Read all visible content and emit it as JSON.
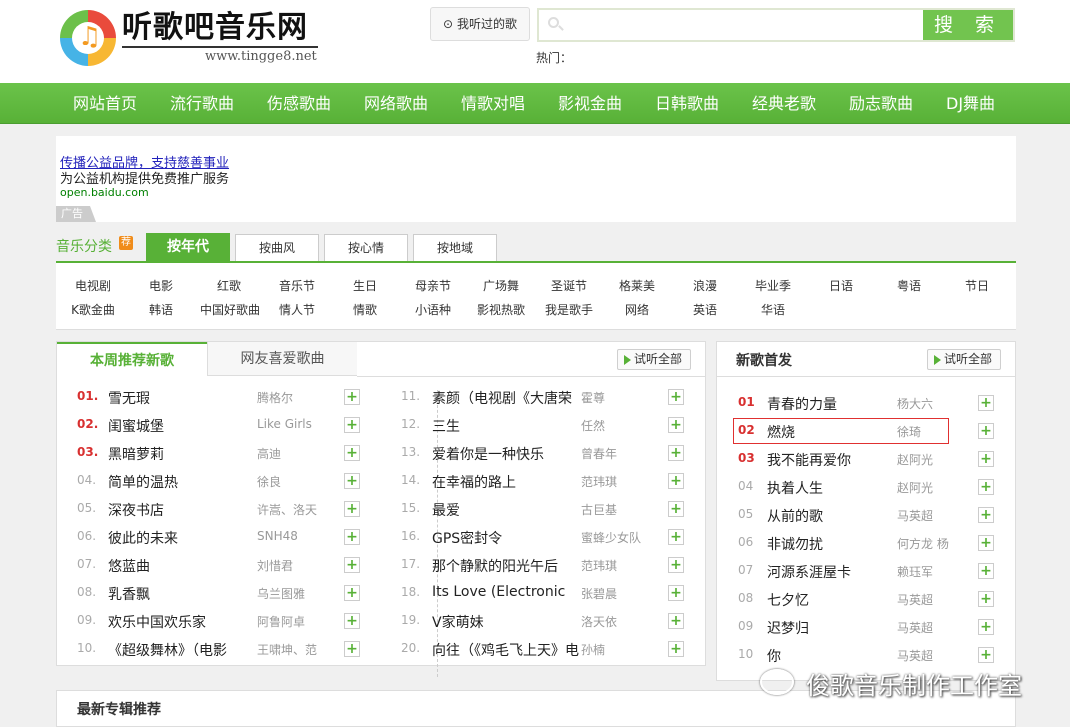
{
  "header": {
    "logo_note": "♫",
    "site_title": "听歌吧音乐网",
    "site_url": "www.tingge8.net",
    "history_label": "我听过的歌",
    "search_placeholder": "",
    "search_button": "搜 索",
    "hot_label": "热门："
  },
  "nav": [
    "网站首页",
    "流行歌曲",
    "伤感歌曲",
    "网络歌曲",
    "情歌对唱",
    "影视金曲",
    "日韩歌曲",
    "经典老歌",
    "励志歌曲",
    "DJ舞曲"
  ],
  "ad": {
    "link": "传播公益品牌，支持慈善事业",
    "description": "为公益机构提供免费推广服务",
    "url": "open.baidu.com",
    "tag": "广告"
  },
  "categories": {
    "label": "音乐分类",
    "badge": "荐",
    "tabs": [
      "按年代",
      "按曲风",
      "按心情",
      "按地域"
    ],
    "active_tab": 0,
    "row1": [
      "电视剧",
      "电影",
      "红歌",
      "音乐节",
      "生日",
      "母亲节",
      "广场舞",
      "圣诞节",
      "格莱美",
      "浪漫",
      "毕业季",
      "日语",
      "粤语",
      "节日"
    ],
    "row2": [
      "K歌金曲",
      "韩语",
      "中国好歌曲",
      "情人节",
      "情歌",
      "小语种",
      "影视热歌",
      "我是歌手",
      "网络",
      "英语",
      "华语"
    ]
  },
  "weekly": {
    "tabs": [
      "本周推荐新歌",
      "网友喜爱歌曲"
    ],
    "listen_all": "试听全部",
    "songs": [
      {
        "num": "01.",
        "title": "雪无瑕",
        "artist": "腾格尔"
      },
      {
        "num": "02.",
        "title": "闺蜜城堡",
        "artist": "Like Girls"
      },
      {
        "num": "03.",
        "title": "黑暗萝莉",
        "artist": "高迪"
      },
      {
        "num": "04.",
        "title": "简单的温热",
        "artist": "徐良"
      },
      {
        "num": "05.",
        "title": "深夜书店",
        "artist": "许嵩、洛天"
      },
      {
        "num": "06.",
        "title": "彼此的未来",
        "artist": "SNH48"
      },
      {
        "num": "07.",
        "title": "悠蓝曲",
        "artist": "刘惜君"
      },
      {
        "num": "08.",
        "title": "乳香飘",
        "artist": "乌兰图雅"
      },
      {
        "num": "09.",
        "title": "欢乐中国欢乐家",
        "artist": "阿鲁阿卓"
      },
      {
        "num": "10.",
        "title": "《超级舞林》（电影",
        "artist": "王啸坤、范"
      },
      {
        "num": "11.",
        "title": "素颜（电视剧《大唐荣",
        "artist": "霍尊"
      },
      {
        "num": "12.",
        "title": "三生",
        "artist": "任然"
      },
      {
        "num": "13.",
        "title": "爱着你是一种快乐",
        "artist": "曾春年"
      },
      {
        "num": "14.",
        "title": "在幸福的路上",
        "artist": "范玮琪"
      },
      {
        "num": "15.",
        "title": "最爱",
        "artist": "古巨基"
      },
      {
        "num": "16.",
        "title": "GPS密封令",
        "artist": "蜜蜂少女队"
      },
      {
        "num": "17.",
        "title": "那个静默的阳光午后",
        "artist": "范玮琪"
      },
      {
        "num": "18.",
        "title": "Its Love (Electronic",
        "artist": "张碧晨"
      },
      {
        "num": "19.",
        "title": "V家萌妹",
        "artist": "洛天依"
      },
      {
        "num": "20.",
        "title": "向往（《鸡毛飞上天》电",
        "artist": "孙楠"
      }
    ]
  },
  "new_songs": {
    "title": "新歌首发",
    "listen_all": "试听全部",
    "songs": [
      {
        "num": "01",
        "title": "青春的力量",
        "artist": "杨大六"
      },
      {
        "num": "02",
        "title": "燃烧",
        "artist": "徐琦"
      },
      {
        "num": "03",
        "title": "我不能再爱你",
        "artist": "赵阿光"
      },
      {
        "num": "04",
        "title": "执着人生",
        "artist": "赵阿光"
      },
      {
        "num": "05",
        "title": "从前的歌",
        "artist": "马英超"
      },
      {
        "num": "06",
        "title": "非诚勿扰",
        "artist": "何方龙 杨"
      },
      {
        "num": "07",
        "title": "河源系涯屋卡",
        "artist": "赖珏军"
      },
      {
        "num": "08",
        "title": "七夕忆",
        "artist": "马英超"
      },
      {
        "num": "09",
        "title": "迟梦归",
        "artist": "马英超"
      },
      {
        "num": "10",
        "title": "你",
        "artist": "马英超"
      }
    ]
  },
  "album_section": {
    "title": "最新专辑推荐"
  },
  "watermark": {
    "text": "俊歌音乐制作工作室"
  },
  "colors": {
    "accent": "#58b137",
    "hot_number": "#d83030",
    "highlight_border": "#e03030"
  },
  "icons": {
    "add": "+",
    "history": "⊙"
  }
}
